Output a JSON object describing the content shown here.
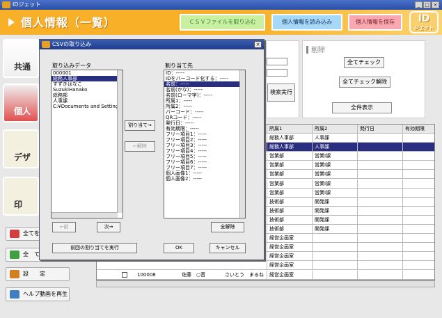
{
  "window": {
    "title": "IDジェット",
    "min": "_",
    "max": "□",
    "close": "×"
  },
  "header": {
    "title": "個人情報（一覧）",
    "btn_import_csv": "ＣＳＶファイルを取り込む",
    "btn_load": "個人情報を読み込み",
    "btn_save": "個人情報を保存",
    "logo": "ID",
    "logo_sub": "ジェット"
  },
  "nav": [
    "共通",
    "個人",
    "デザ",
    "印"
  ],
  "side_buttons": [
    "全てを",
    "全　て",
    "設　　定",
    "ヘルプ動画を再生"
  ],
  "search": {
    "button": "検索実行"
  },
  "delete_panel": {
    "title": "削除",
    "select_all": "全てチェック",
    "unselect_all": "全てチェック解除",
    "show_all": "全件表示"
  },
  "table": {
    "headers": [
      "所属1",
      "所属2",
      "発行日",
      "有効期限"
    ],
    "rows": [
      [
        "総務人事部",
        "人事課"
      ],
      [
        "総務人事部",
        "人事課"
      ],
      [
        "営業部",
        "営業Ⅰ課"
      ],
      [
        "営業部",
        "営業Ⅰ課"
      ],
      [
        "営業部",
        "営業Ⅰ課"
      ],
      [
        "営業部",
        "営業Ⅰ課"
      ],
      [
        "営業部",
        "営業Ⅰ課"
      ],
      [
        "技術部",
        "開発課"
      ],
      [
        "技術部",
        "開発課"
      ],
      [
        "技術部",
        "開発課"
      ],
      [
        "技術部",
        "開発課"
      ],
      [
        "経営企画室",
        ""
      ],
      [
        "経営企画室",
        ""
      ],
      [
        "経営企画室",
        ""
      ],
      [
        "経営企画室",
        ""
      ]
    ],
    "last_row": {
      "id": "100008",
      "name": "佐藤　○音",
      "kana": "さいとう　まるね",
      "dept": "経営企画室"
    }
  },
  "dialog": {
    "title": "CSVの取り込み",
    "close": "×",
    "import_label": "取り込みデータ",
    "import_items": [
      "000001",
      "総務人事部",
      "すずきはなこ",
      "SuzukiHanako",
      "総務部",
      "人事課",
      "C:¥Documents and Settings¥A"
    ],
    "assign_label": "割り当て先",
    "assign_items": [
      "ID：-----",
      "IDをバーコード化する：-----",
      "名前：-----",
      "名前(かな)：-----",
      "名前(ローマ字)：-----",
      "所属1：-----",
      "所属2：-----",
      "バーコード：-----",
      "QRコード：-----",
      "発行日：-----",
      "有効期限：-----",
      "フリー項目1：-----",
      "フリー項目2：-----",
      "フリー項目3：-----",
      "フリー項目4：-----",
      "フリー項目5：-----",
      "フリー項目6：-----",
      "フリー項目7：-----",
      "個人画像1：-----",
      "個人画像2：-----"
    ],
    "btn_assign": "割り当て→",
    "btn_unassign": "←解除",
    "btn_prev": "←前",
    "btn_next": "次→",
    "btn_clear_all": "全解除",
    "btn_prev_assign": "前回の割り当てを実行",
    "btn_ok": "OK",
    "btn_cancel": "キャンセル"
  }
}
